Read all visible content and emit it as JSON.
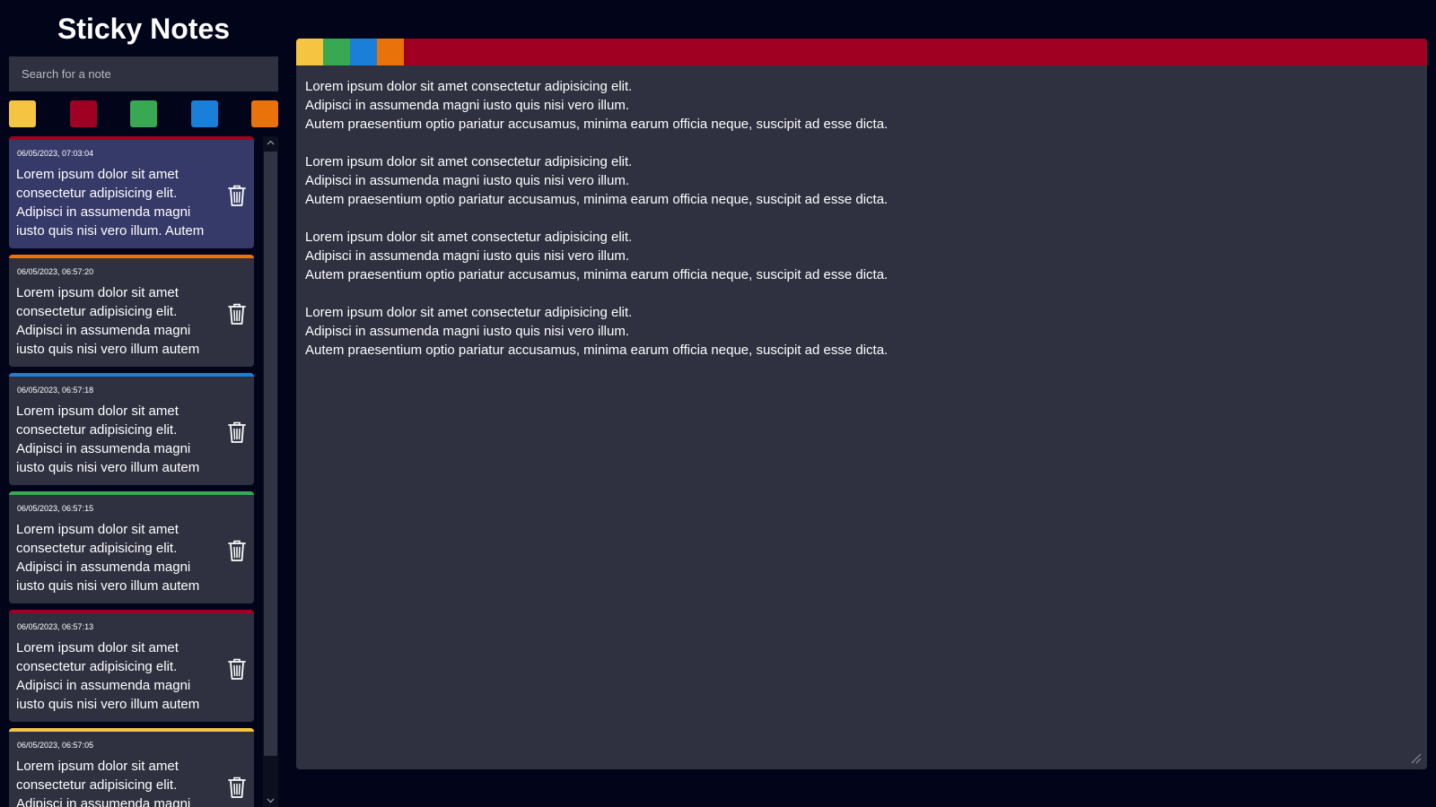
{
  "app": {
    "title": "Sticky Notes"
  },
  "search": {
    "placeholder": "Search for a note"
  },
  "colors": {
    "yellow": "#f5c542",
    "red": "#a00122",
    "green": "#38a852",
    "blue": "#1a7fd8",
    "orange": "#e9730a"
  },
  "filters": [
    "yellow",
    "red",
    "green",
    "blue",
    "orange"
  ],
  "editor_colors": [
    "yellow",
    "green",
    "blue",
    "orange"
  ],
  "notes": [
    {
      "date": "06/05/2023, 07:03:04",
      "preview": "Lorem ipsum dolor sit amet consectetur adipisicing elit. Adipisci in assumenda magni iusto quis nisi vero illum. Autem",
      "color": "red",
      "active": true
    },
    {
      "date": "06/05/2023, 06:57:20",
      "preview": "Lorem ipsum dolor sit amet consectetur adipisicing elit. Adipisci in assumenda magni iusto quis nisi vero illum autem",
      "color": "orange",
      "active": false
    },
    {
      "date": "06/05/2023, 06:57:18",
      "preview": "Lorem ipsum dolor sit amet consectetur adipisicing elit. Adipisci in assumenda magni iusto quis nisi vero illum autem",
      "color": "blue",
      "active": false
    },
    {
      "date": "06/05/2023, 06:57:15",
      "preview": "Lorem ipsum dolor sit amet consectetur adipisicing elit. Adipisci in assumenda magni iusto quis nisi vero illum autem",
      "color": "green",
      "active": false
    },
    {
      "date": "06/05/2023, 06:57:13",
      "preview": "Lorem ipsum dolor sit amet consectetur adipisicing elit. Adipisci in assumenda magni iusto quis nisi vero illum autem",
      "color": "red",
      "active": false
    },
    {
      "date": "06/05/2023, 06:57:05",
      "preview": "Lorem ipsum dolor sit amet consectetur adipisicing elit. Adipisci in assumenda magni",
      "color": "yellow",
      "active": false
    }
  ],
  "editor": {
    "color": "red",
    "text": "Lorem ipsum dolor sit amet consectetur adipisicing elit.\nAdipisci in assumenda magni iusto quis nisi vero illum.\nAutem praesentium optio pariatur accusamus, minima earum officia neque, suscipit ad esse dicta.\n\nLorem ipsum dolor sit amet consectetur adipisicing elit.\nAdipisci in assumenda magni iusto quis nisi vero illum.\nAutem praesentium optio pariatur accusamus, minima earum officia neque, suscipit ad esse dicta.\n\nLorem ipsum dolor sit amet consectetur adipisicing elit.\nAdipisci in assumenda magni iusto quis nisi vero illum.\nAutem praesentium optio pariatur accusamus, minima earum officia neque, suscipit ad esse dicta.\n\nLorem ipsum dolor sit amet consectetur adipisicing elit.\nAdipisci in assumenda magni iusto quis nisi vero illum.\nAutem praesentium optio pariatur accusamus, minima earum officia neque, suscipit ad esse dicta."
  },
  "icons": {
    "delete": "trash-icon",
    "scroll_up": "chevron-up-icon",
    "scroll_down": "chevron-down-icon",
    "resize": "resize-grip-icon"
  }
}
